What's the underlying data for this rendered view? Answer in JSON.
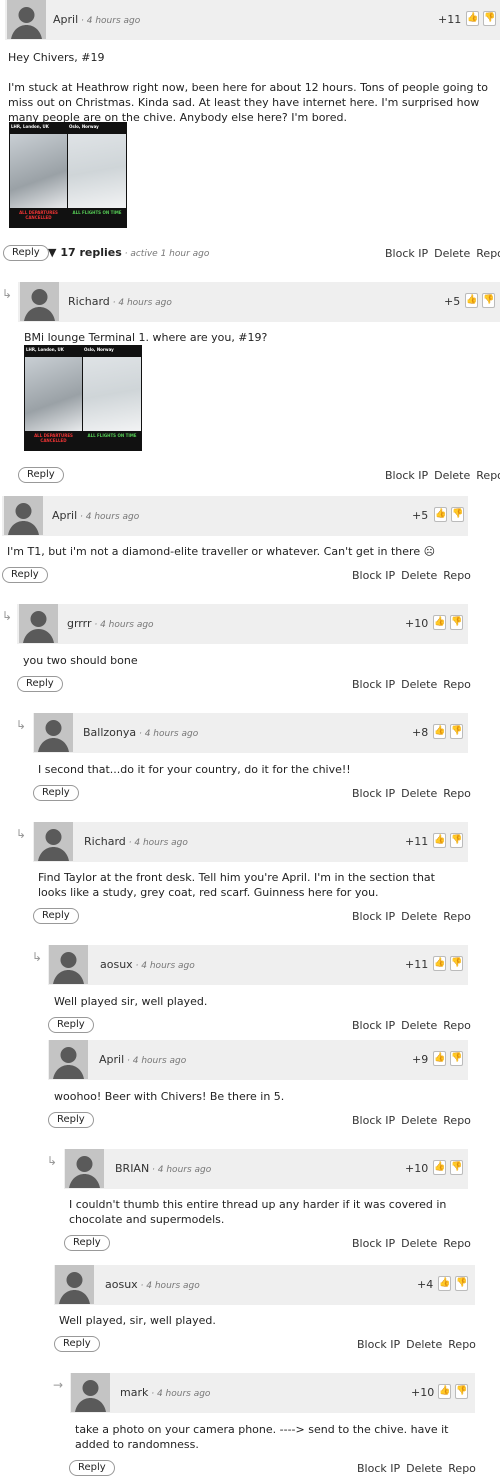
{
  "comments": [
    {
      "author": "April",
      "time": " · 4 hours ago",
      "score": "+11",
      "body": "Hey Chivers, #19\n\nI'm stuck at Heathrow right now, been here for about 12 hours. Tons of people going to miss out on Christmas. Kinda sad. At least they have internet here. I'm surprised how many people are on the chive. Anybody else here? I'm bored.",
      "image": {
        "left_title": "LHR, London, UK",
        "right_title": "Oslo, Norway",
        "left_caption": "ALL DEPARTURES CANCELLED",
        "right_caption": "ALL FLIGHTS ON TIME"
      }
    },
    {
      "author": "Richard",
      "time": " · 4 hours ago",
      "score": "+5",
      "body": "BMi lounge Terminal 1. where are you, #19?",
      "image": {
        "left_title": "LHR, London, UK",
        "right_title": "Oslo, Norway",
        "left_caption": "ALL DEPARTURES CANCELLED",
        "right_caption": "ALL FLIGHTS ON TIME"
      }
    },
    {
      "author": "April",
      "time": " · 4 hours ago",
      "score": "+5",
      "body": "I'm T1, but i'm not a diamond-elite traveller or whatever. Can't get in there ☹"
    },
    {
      "author": "grrrr",
      "time": " · 4 hours ago",
      "score": "+10",
      "body": "you two should bone"
    },
    {
      "author": "Ballzonya",
      "time": " · 4 hours ago",
      "score": "+8",
      "body": "I second that...do it for your country, do it for the chive!!"
    },
    {
      "author": "Richard",
      "time": " · 4 hours ago",
      "score": "+11",
      "body": "Find Taylor at the front desk. Tell him you're April. I'm in the section that looks like a study, grey coat, red scarf. Guinness here for you."
    },
    {
      "author": "aosux",
      "time": " · 4 hours ago",
      "score": "+11",
      "body": "Well played sir, well played."
    },
    {
      "author": "April",
      "time": " · 4 hours ago",
      "score": "+9",
      "body": "woohoo! Beer with Chivers! Be there in 5."
    },
    {
      "author": "BRIAN",
      "time": " · 4 hours ago",
      "score": "+10",
      "body": "I couldn't thumb this entire thread up any harder if it was covered in chocolate and supermodels."
    },
    {
      "author": "aosux",
      "time": " · 4 hours ago",
      "score": "+4",
      "body": "Well played, sir, well played."
    },
    {
      "author": "mark",
      "time": " · 4 hours ago",
      "score": "+10",
      "body": "take a photo on your camera phone. ----> send to the chive. have it added to randomness."
    }
  ],
  "labels": {
    "reply": "Reply",
    "block_ip": "Block IP",
    "delete": "Delete",
    "report": "Repo",
    "replies_count": "17 replies",
    "replies_active": " · active 1 hour ago",
    "toggle": "▼"
  },
  "icons": {
    "thumb_up": "thumbs-up-icon",
    "thumb_down": "thumbs-down-icon",
    "reply_arrow": "reply-arrow-icon"
  },
  "colors": {
    "header_bg": "#efefef",
    "up": "#6aa84f",
    "down": "#cc6666"
  }
}
